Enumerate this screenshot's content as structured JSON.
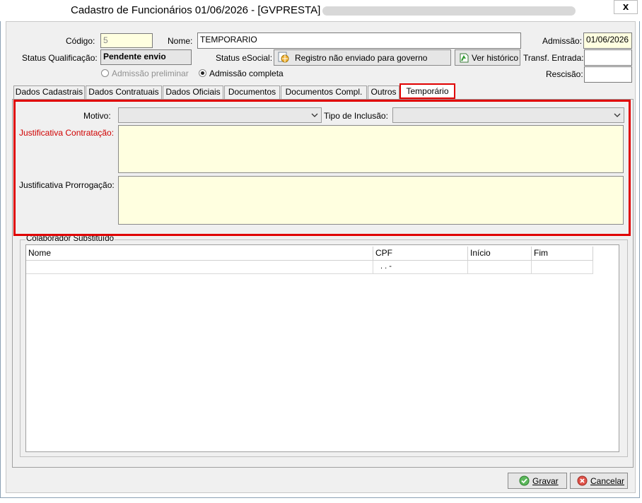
{
  "window": {
    "title": "Cadastro de Funcionários  01/06/2026 - [GVPRESTA] -",
    "close_label": "x"
  },
  "header": {
    "codigo_label": "Código:",
    "codigo_value": "5",
    "nome_label": "Nome:",
    "nome_value": "TEMPORARIO",
    "admissao_label": "Admissão:",
    "admissao_value": "01/06/2026",
    "status_qualificacao_label": "Status Qualificação:",
    "status_qualificacao_value": "Pendente envio",
    "status_esocial_label": "Status eSocial:",
    "status_esocial_value": "Registro não enviado para governo",
    "ver_historico_label": "Ver histórico",
    "transf_entrada_label": "Transf. Entrada:",
    "transf_entrada_value": "",
    "rescisao_label": "Rescisão:",
    "rescisao_value": "",
    "radio_preliminar_label": "Admissão preliminar",
    "radio_completa_label": "Admissão completa"
  },
  "tabs": [
    {
      "label": "Dados Cadastrais"
    },
    {
      "label": "Dados Contratuais"
    },
    {
      "label": "Dados Oficiais"
    },
    {
      "label": "Documentos"
    },
    {
      "label": "Documentos Compl."
    },
    {
      "label": "Outros"
    },
    {
      "label": "Temporário"
    }
  ],
  "temporario": {
    "motivo_label": "Motivo:",
    "motivo_value": "",
    "tipo_inclusao_label": "Tipo de Inclusão:",
    "tipo_inclusao_value": "",
    "justificativa_contratacao_label": "Justificativa Contratação:",
    "justificativa_contratacao_value": "",
    "justificativa_prorrogacao_label": "Justificativa Prorrogação:",
    "justificativa_prorrogacao_value": "",
    "group_label": "Colaborador Substituído",
    "columns": [
      "Nome",
      "CPF",
      "Início",
      "Fim"
    ],
    "rows": [
      {
        "nome": "",
        "cpf": ". . -",
        "inicio": "",
        "fim": ""
      }
    ]
  },
  "footer": {
    "gravar_label": "Gravar",
    "cancelar_label": "Cancelar"
  },
  "colors": {
    "highlight": "#e00000",
    "required_label": "#d00000",
    "memo_bg": "#ffffe0"
  },
  "icons": [
    "close-icon",
    "globe-document-icon",
    "history-icon",
    "check-icon",
    "cancel-icon",
    "chevron-down-icon"
  ]
}
